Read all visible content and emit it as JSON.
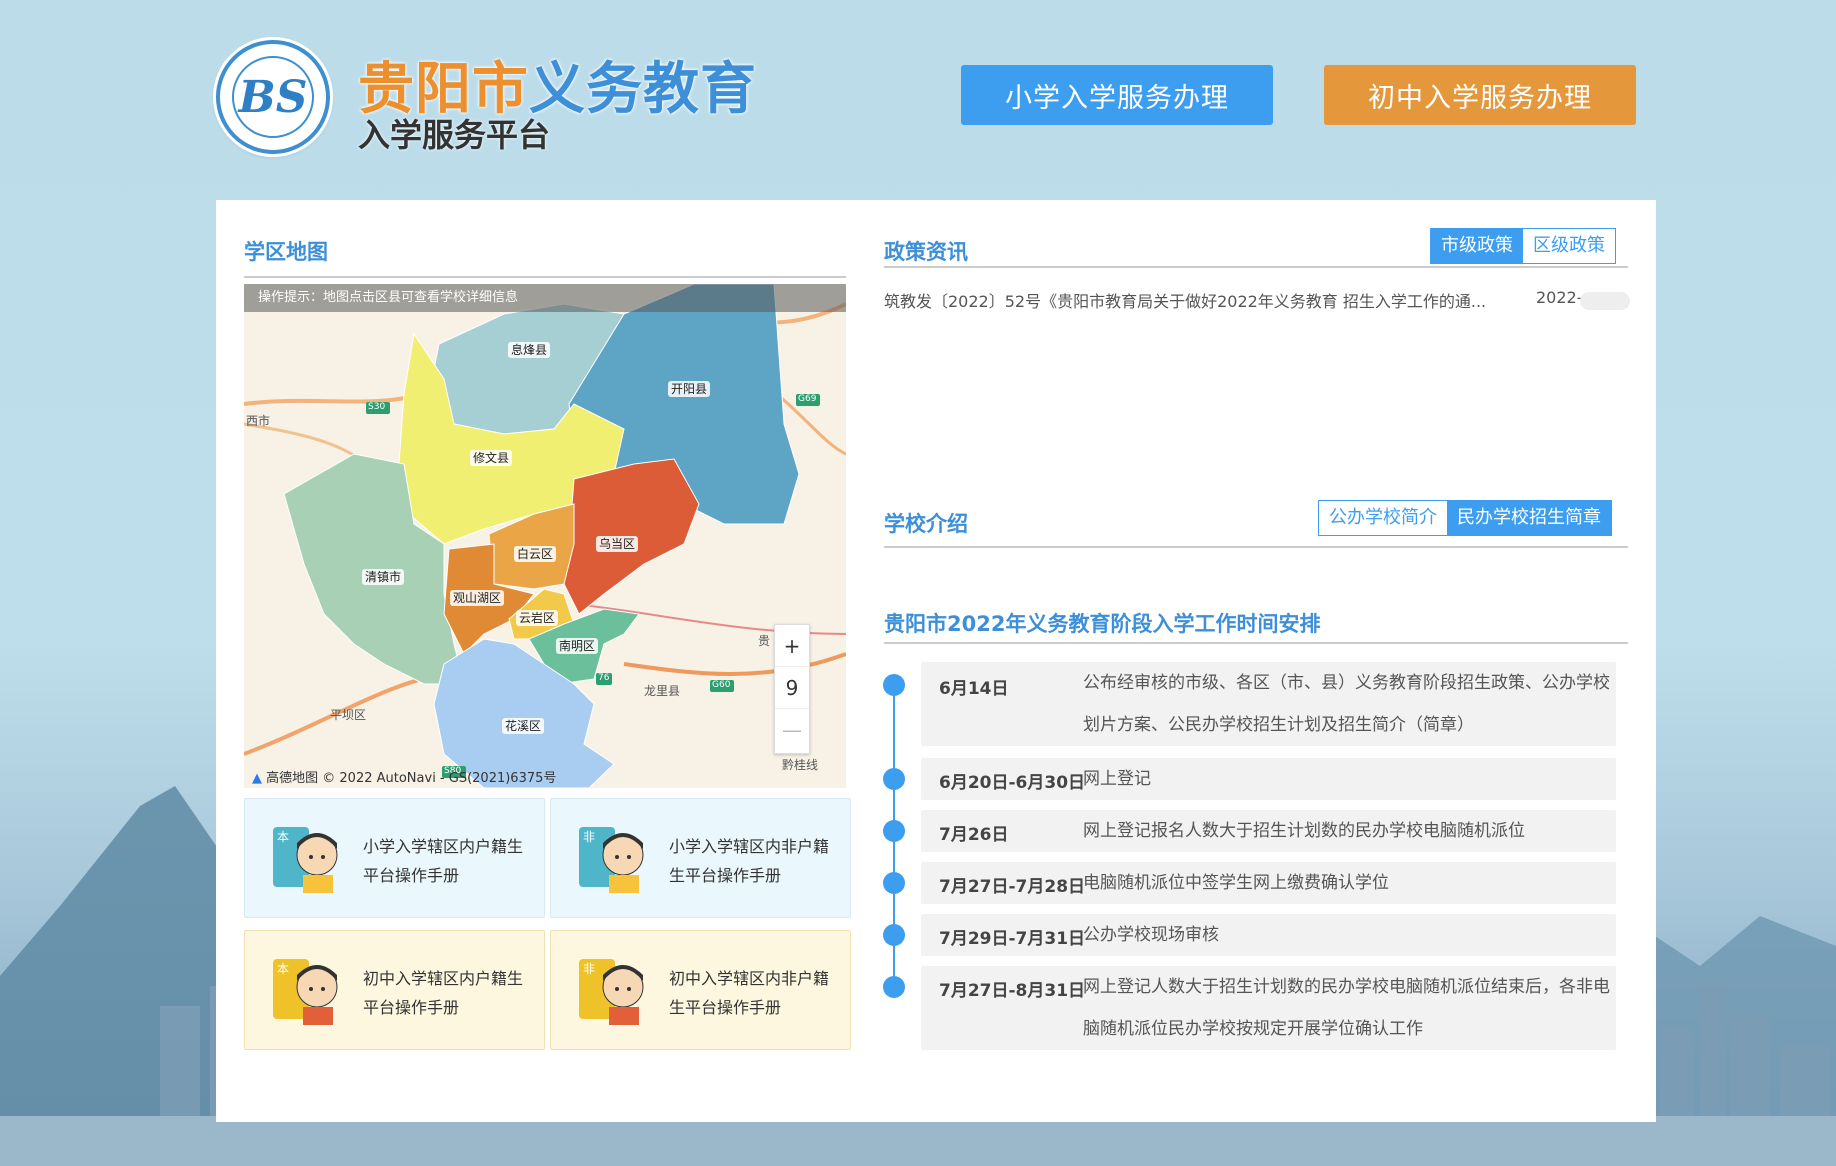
{
  "header": {
    "title_part1": "贵阳市",
    "title_part2": "义务教育",
    "subtitle": "入学服务平台",
    "logo_letter": "BS",
    "primary_button": "小学入学服务办理",
    "junior_button": "初中入学服务办理"
  },
  "map_section": {
    "title": "学区地图",
    "tip": "操作提示：地图点击区县可查看学校详细信息",
    "districts": [
      "息烽县",
      "开阳县",
      "修文县",
      "清镇市",
      "白云区",
      "乌当区",
      "观山湖区",
      "云岩区",
      "南明区",
      "花溪区"
    ],
    "place_texts": [
      "西市",
      "平坝区",
      "龙里县",
      "贵",
      "黔桂线"
    ],
    "road_badges": [
      "S30",
      "G69",
      "G60",
      "S80",
      "76"
    ],
    "zoom_in": "+",
    "zoom_level": "9",
    "zoom_out": "—",
    "copyright": "高德地图 © 2022 AutoNavi - GS(2021)6375号"
  },
  "manuals": [
    {
      "badge": "本",
      "text": "小学入学辖区内户籍生平台操作手册"
    },
    {
      "badge": "非",
      "text": "小学入学辖区内非户籍生平台操作手册"
    },
    {
      "badge": "本",
      "text": "初中入学辖区内户籍生平台操作手册"
    },
    {
      "badge": "非",
      "text": "初中入学辖区内非户籍生平台操作手册"
    }
  ],
  "policy": {
    "title": "政策资讯",
    "tabs": [
      "市级政策",
      "区级政策"
    ],
    "news_title": "筑教发〔2022〕52号《贵阳市教育局关于做好2022年义务教育 招生入学工作的通...",
    "news_date": "2022-"
  },
  "school_intro": {
    "title": "学校介绍",
    "tabs": [
      "公办学校简介",
      "民办学校招生简章"
    ]
  },
  "schedule": {
    "title": "贵阳市2022年义务教育阶段入学工作时间安排",
    "items": [
      {
        "date": "6月14日",
        "desc": "公布经审核的市级、各区（市、县）义务教育阶段招生政策、公办学校划片方案、公民办学校招生计划及招生简介（简章）"
      },
      {
        "date": "6月20日-6月30日",
        "desc": "网上登记"
      },
      {
        "date": "7月26日",
        "desc": "网上登记报名人数大于招生计划数的民办学校电脑随机派位"
      },
      {
        "date": "7月27日-7月28日",
        "desc": "电脑随机派位中签学生网上缴费确认学位"
      },
      {
        "date": "7月29日-7月31日",
        "desc": "公办学校现场审核"
      },
      {
        "date": "7月27日-8月31日",
        "desc": "网上登记人数大于招生计划数的民办学校电脑随机派位结束后，各非电脑随机派位民办学校按规定开展学位确认工作"
      }
    ]
  },
  "colors": {
    "brand_blue": "#3d9ef0",
    "brand_orange": "#e4983b",
    "title_orange": "#ec8f2e"
  }
}
